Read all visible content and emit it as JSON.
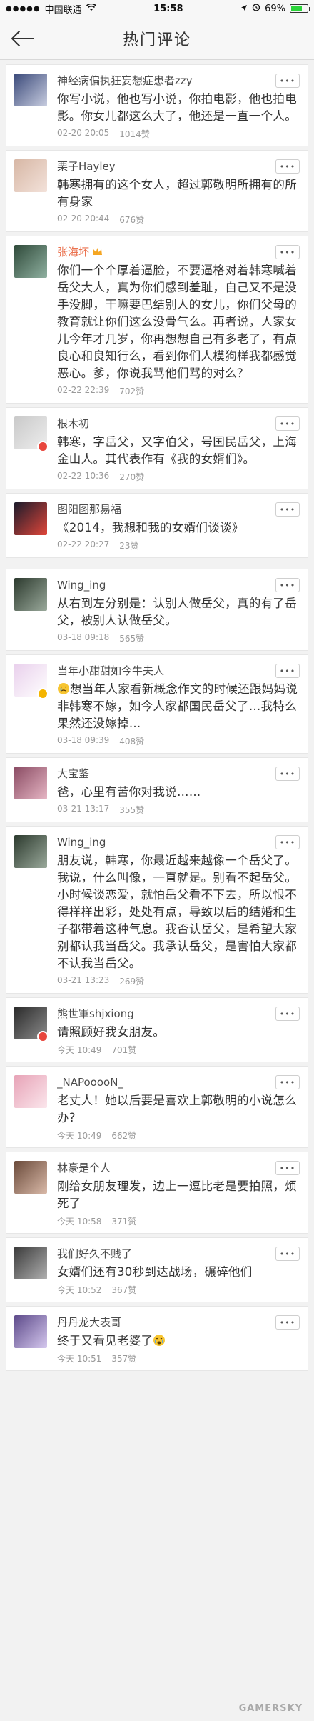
{
  "status": {
    "carrier": "中国联通",
    "time": "15:58",
    "battery": "69%",
    "battery_level": 0.69
  },
  "header": {
    "title": "热门评论"
  },
  "more_label": "•••",
  "comments": [
    {
      "user": "神经病偏执狂妄想症患者zzy",
      "text": "你写小说，他也写小说，你拍电影，他也拍电影。你女儿都这么大了，他还是一直一个人。",
      "date": "02-20 20:05",
      "likes": "1014赞",
      "avatar": "anime-avatar",
      "avatar_colors": [
        "#3b4a7a",
        "#c8cde0"
      ]
    },
    {
      "user": "栗子Hayley",
      "text": "韩寒拥有的这个女人，超过郭敬明所拥有的所有身家",
      "date": "02-20 20:44",
      "likes": "676赞",
      "avatar": "girl-avatar",
      "avatar_colors": [
        "#d7b7a5",
        "#f3e2da"
      ]
    },
    {
      "user": "张海坏",
      "text": "你们一个个厚着逼脸，不要逼格对着韩寒喊着岳父大人，真为你们感到羞耻，自己又不是没手没脚，干嘛要巴结别人的女儿，你们父母的教育就让你们这么没骨气么。再者说，人家女儿今年才几岁，你再想想自己有多老了，有点良心和良知行么，看到你们人模狗样我都感觉恶心。爹，你说我骂他们骂的对么？",
      "date": "02-22 22:39",
      "likes": "702赞",
      "avatar": "landscape-avatar",
      "avatar_colors": [
        "#2f4a3a",
        "#8fb0a0"
      ]
    },
    {
      "user": "根木初",
      "text": "韩寒，字岳父，又字伯父，号国民岳父，上海金山人。其代表作有《我的女婿们》。",
      "date": "02-22 10:36",
      "likes": "270赞",
      "avatar": "default-avatar",
      "avatar_colors": [
        "#c9c9c9",
        "#eeeeee"
      ]
    },
    {
      "user": "图阳图那易福",
      "text": "《2014，我想和我的女婿们谈谈》",
      "date": "02-22 20:27",
      "likes": "23赞",
      "avatar": "colorbar-avatar",
      "avatar_colors": [
        "#1b1b2b",
        "#e0463a"
      ]
    },
    {
      "user": "Wing_ing",
      "text": "从右到左分别是：认别人做岳父，真的有了岳父，被别人认做岳父。",
      "date": "03-18 09:18",
      "likes": "565赞",
      "avatar": "tree-avatar",
      "avatar_colors": [
        "#2c3a2e",
        "#9aa99b"
      ]
    },
    {
      "user": "当年小甜甜如今牛夫人",
      "text": "想当年人家看新概念作文的时候还跟妈妈说非韩寒不嫁，如今人家都国民岳父了…我特么果然还没嫁掉…",
      "date": "03-18 09:39",
      "likes": "408赞",
      "avatar": "cartoon-avatar",
      "avatar_colors": [
        "#e9d0ec",
        "#ffffff"
      ]
    },
    {
      "user": "大宝鉴",
      "text": "爸，心里有苦你对我说……",
      "date": "03-21 13:17",
      "likes": "355赞",
      "avatar": "girl2-avatar",
      "avatar_colors": [
        "#8a4b63",
        "#e6b6c4"
      ]
    },
    {
      "user": "Wing_ing",
      "text": "朋友说，韩寒，你最近越来越像一个岳父了。我说，什么叫像，一直就是。别看不起岳父。小时候谈恋爱，就怕岳父看不下去，所以恨不得样样出彩，处处有点，导致以后的结婚和生子都带着这种气息。我否认岳父，是希望大家别都认我当岳父。我承认岳父，是害怕大家都不认我当岳父。",
      "date": "03-21 13:23",
      "likes": "269赞",
      "avatar": "tree-avatar",
      "avatar_colors": [
        "#2c3a2e",
        "#9aa99b"
      ]
    },
    {
      "user": "熊世軍shjxiong",
      "text": "请照顾好我女朋友。",
      "date": "今天 10:49",
      "likes": "701赞",
      "avatar": "man-avatar",
      "avatar_colors": [
        "#2a2a2a",
        "#8c8c8c"
      ]
    },
    {
      "user": "_NAPooooN_",
      "text": "老丈人！她以后要是喜欢上郭敬明的小说怎么办?",
      "date": "今天 10:49",
      "likes": "662赞",
      "avatar": "pink-avatar",
      "avatar_colors": [
        "#e7a3b7",
        "#fbe6ec"
      ]
    },
    {
      "user": "林豪是个人",
      "text": "刚给女朋友理发，边上一逗比老是要拍照，烦死了",
      "date": "今天 10:58",
      "likes": "371赞",
      "avatar": "girl3-avatar",
      "avatar_colors": [
        "#6a4a3a",
        "#d9b9a8"
      ]
    },
    {
      "user": "我们好久不贱了",
      "text": "女婿们还有30秒到达战场，碾碎他们",
      "date": "今天 10:52",
      "likes": "367赞",
      "avatar": "man2-avatar",
      "avatar_colors": [
        "#3a3a3a",
        "#b0b0b0"
      ]
    },
    {
      "user": "丹丹龙大表哥",
      "text": "终于又看见老婆了",
      "date": "今天 10:51",
      "likes": "357赞",
      "avatar": "purple-avatar",
      "avatar_colors": [
        "#5d4a8a",
        "#d5c8ee"
      ]
    }
  ],
  "watermark": "GAMERSKY"
}
